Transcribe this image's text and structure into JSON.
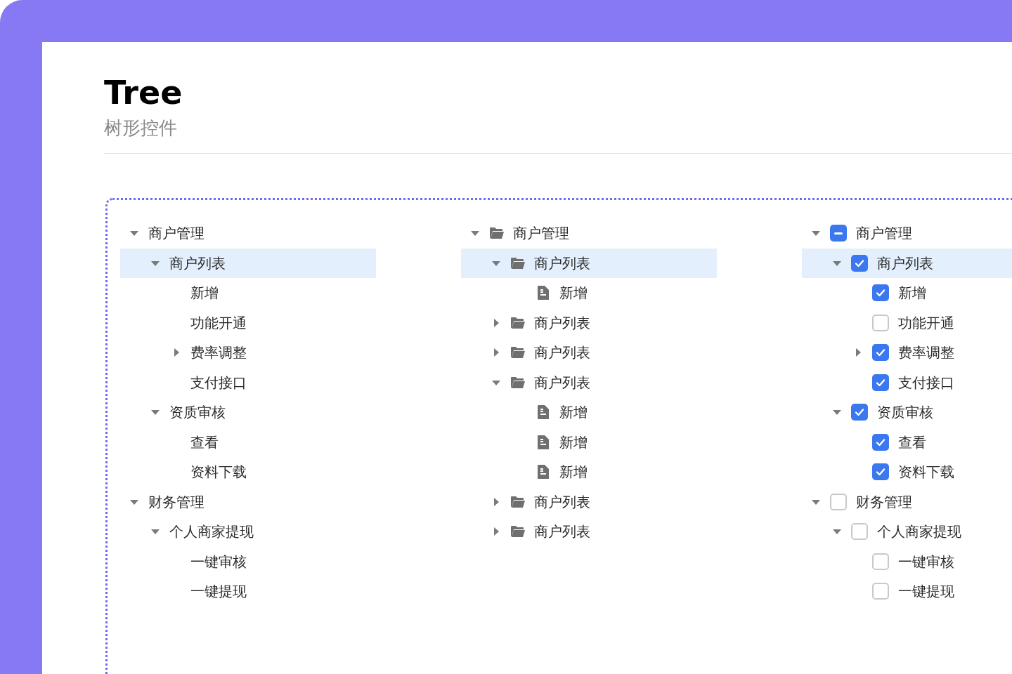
{
  "header": {
    "title": "Tree",
    "subtitle": "树形控件"
  },
  "trees": [
    {
      "kind": "plain",
      "nodes": [
        {
          "label": "商户管理",
          "kind": "branch",
          "expanded": true,
          "selected": false,
          "children": [
            {
              "label": "商户列表",
              "kind": "branch",
              "expanded": true,
              "selected": true,
              "children": [
                {
                  "label": "新增",
                  "kind": "leaf",
                  "selected": false
                },
                {
                  "label": "功能开通",
                  "kind": "leaf",
                  "selected": false
                },
                {
                  "label": "费率调整",
                  "kind": "branch",
                  "expanded": false,
                  "selected": false
                },
                {
                  "label": "支付接口",
                  "kind": "leaf",
                  "selected": false
                }
              ]
            },
            {
              "label": "资质审核",
              "kind": "branch",
              "expanded": true,
              "selected": false,
              "children": [
                {
                  "label": "查看",
                  "kind": "leaf",
                  "selected": false
                },
                {
                  "label": "资料下载",
                  "kind": "leaf",
                  "selected": false
                }
              ]
            }
          ]
        },
        {
          "label": "财务管理",
          "kind": "branch",
          "expanded": true,
          "selected": false,
          "children": [
            {
              "label": "个人商家提现",
              "kind": "branch",
              "expanded": true,
              "selected": false,
              "children": [
                {
                  "label": "一键审核",
                  "kind": "leaf",
                  "selected": false
                },
                {
                  "label": "一键提现",
                  "kind": "leaf",
                  "selected": false
                }
              ]
            }
          ]
        }
      ]
    },
    {
      "kind": "icons",
      "nodes": [
        {
          "label": "商户管理",
          "kind": "folder",
          "expanded": true,
          "selected": false,
          "children": [
            {
              "label": "商户列表",
              "kind": "folder",
              "expanded": true,
              "selected": true,
              "children": [
                {
                  "label": "新增",
                  "kind": "file",
                  "selected": false
                }
              ]
            },
            {
              "label": "商户列表",
              "kind": "folder",
              "expanded": false,
              "selected": false
            },
            {
              "label": "商户列表",
              "kind": "folder",
              "expanded": false,
              "selected": false
            },
            {
              "label": "商户列表",
              "kind": "folder",
              "expanded": true,
              "selected": false,
              "children": [
                {
                  "label": "新增",
                  "kind": "file",
                  "selected": false
                },
                {
                  "label": "新增",
                  "kind": "file",
                  "selected": false
                },
                {
                  "label": "新增",
                  "kind": "file",
                  "selected": false
                }
              ]
            },
            {
              "label": "商户列表",
              "kind": "folder",
              "expanded": false,
              "selected": false
            },
            {
              "label": "商户列表",
              "kind": "folder",
              "expanded": false,
              "selected": false
            }
          ]
        }
      ]
    },
    {
      "kind": "checkbox",
      "nodes": [
        {
          "label": "商户管理",
          "kind": "branch",
          "expanded": true,
          "selected": false,
          "checked": true,
          "indeterminate": true,
          "children": [
            {
              "label": "商户列表",
              "kind": "branch",
              "expanded": true,
              "selected": true,
              "checked": true,
              "children": [
                {
                  "label": "新增",
                  "kind": "leaf",
                  "selected": false,
                  "checked": true
                },
                {
                  "label": "功能开通",
                  "kind": "leaf",
                  "selected": false,
                  "checked": false
                },
                {
                  "label": "费率调整",
                  "kind": "branch",
                  "expanded": false,
                  "selected": false,
                  "checked": true
                },
                {
                  "label": "支付接口",
                  "kind": "leaf",
                  "selected": false,
                  "checked": true
                }
              ]
            },
            {
              "label": "资质审核",
              "kind": "branch",
              "expanded": true,
              "selected": false,
              "checked": true,
              "children": [
                {
                  "label": "查看",
                  "kind": "leaf",
                  "selected": false,
                  "checked": true
                },
                {
                  "label": "资料下载",
                  "kind": "leaf",
                  "selected": false,
                  "checked": true
                }
              ]
            }
          ]
        },
        {
          "label": "财务管理",
          "kind": "branch",
          "expanded": true,
          "selected": false,
          "checked": false,
          "children": [
            {
              "label": "个人商家提现",
              "kind": "branch",
              "expanded": true,
              "selected": false,
              "checked": false,
              "children": [
                {
                  "label": "一键审核",
                  "kind": "leaf",
                  "selected": false,
                  "checked": false
                },
                {
                  "label": "一键提现",
                  "kind": "leaf",
                  "selected": false,
                  "checked": false
                }
              ]
            }
          ]
        }
      ]
    }
  ]
}
